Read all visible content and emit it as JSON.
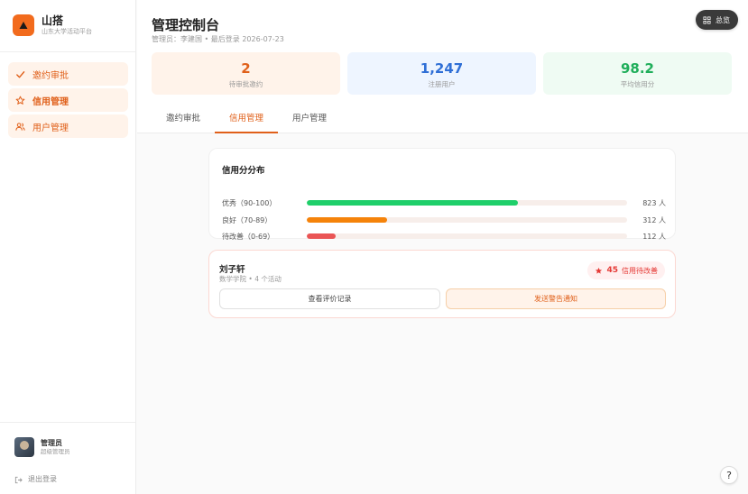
{
  "app": {
    "name": "山搭",
    "subtitle": "山东大学活动平台"
  },
  "sidebar": {
    "items": [
      {
        "label": "邀约审批",
        "icon": "check-icon"
      },
      {
        "label": "信用管理",
        "icon": "star-icon"
      },
      {
        "label": "用户管理",
        "icon": "users-icon"
      }
    ],
    "active_index": 1
  },
  "user": {
    "name": "管理员",
    "role": "超级管理员"
  },
  "logout_label": "退出登录",
  "header": {
    "title": "管理控制台",
    "subtitle": "管理员：李建国 • 最后登录 2026-07-23",
    "overview_label": "总览"
  },
  "stats": [
    {
      "value": "2",
      "label": "待审批邀约",
      "color": "#e0601a",
      "bg": "#fff3ea"
    },
    {
      "value": "1,247",
      "label": "注册用户",
      "color": "#2f6fd6",
      "bg": "#eef5ff"
    },
    {
      "value": "98.2",
      "label": "平均信用分",
      "color": "#1fae5a",
      "bg": "#effbf3"
    }
  ],
  "tabs": [
    {
      "label": "邀约审批"
    },
    {
      "label": "信用管理"
    },
    {
      "label": "用户管理"
    }
  ],
  "active_tab": 1,
  "distribution": {
    "title": "信用分分布",
    "rows": [
      {
        "label": "优秀（90-100）",
        "count": "823 人",
        "fraction": 0.66,
        "color": "#1fcf6a"
      },
      {
        "label": "良好（70-89）",
        "count": "312 人",
        "fraction": 0.25,
        "color": "#f5830a"
      },
      {
        "label": "待改善（0-69）",
        "count": "112 人",
        "fraction": 0.09,
        "color": "#ea5555"
      }
    ]
  },
  "flagged_user": {
    "name": "刘子轩",
    "meta": "数学学院 • 4 个活动",
    "score": "45",
    "badge_label": "信用待改善",
    "view_button": "查看评价记录",
    "warn_button": "发送警告通知"
  },
  "help_label": "?"
}
